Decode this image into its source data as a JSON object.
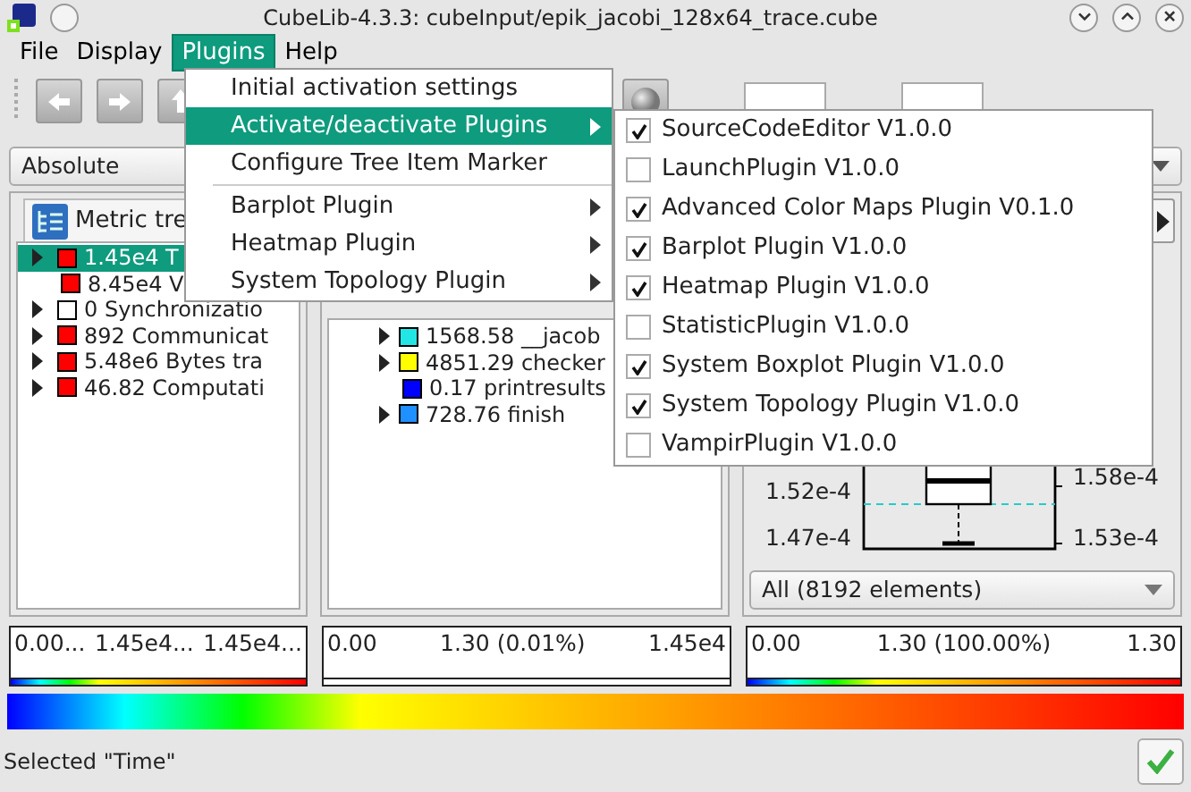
{
  "window": {
    "title": "CubeLib-4.3.3: cubeInput/epik_jacobi_128x64_trace.cube"
  },
  "menubar": [
    {
      "label": "File",
      "selected": false
    },
    {
      "label": "Display",
      "selected": false
    },
    {
      "label": "Plugins",
      "selected": true
    },
    {
      "label": "Help",
      "selected": false
    }
  ],
  "plugins_menu": {
    "items": [
      {
        "kind": "item",
        "label": "Initial activation settings",
        "selected": false,
        "submenu": false
      },
      {
        "kind": "item",
        "label": "Activate/deactivate Plugins",
        "selected": true,
        "submenu": true
      },
      {
        "kind": "item",
        "label": "Configure Tree Item Marker",
        "selected": false,
        "submenu": false
      },
      {
        "kind": "separator"
      },
      {
        "kind": "item",
        "label": "Barplot Plugin",
        "selected": false,
        "submenu": true
      },
      {
        "kind": "item",
        "label": "Heatmap Plugin",
        "selected": false,
        "submenu": true
      },
      {
        "kind": "item",
        "label": "System Topology Plugin",
        "selected": false,
        "submenu": true
      }
    ]
  },
  "plugins_submenu": {
    "items": [
      {
        "label": "SourceCodeEditor V1.0.0",
        "checked": true
      },
      {
        "label": "LaunchPlugin V1.0.0",
        "checked": false
      },
      {
        "label": "Advanced Color Maps Plugin V0.1.0",
        "checked": true
      },
      {
        "label": "Barplot Plugin V1.0.0",
        "checked": true
      },
      {
        "label": "Heatmap Plugin V1.0.0",
        "checked": true
      },
      {
        "label": "StatisticPlugin V1.0.0",
        "checked": false
      },
      {
        "label": "System Boxplot Plugin V1.0.0",
        "checked": true
      },
      {
        "label": "System Topology Plugin V1.0.0",
        "checked": true
      },
      {
        "label": "VampirPlugin V1.0.0",
        "checked": false
      }
    ]
  },
  "left_panel": {
    "mode": "Absolute",
    "tab": "Metric tre",
    "rows": [
      {
        "label": "1.45e4 T",
        "color": "#ff0000",
        "expandable": true,
        "selected": true
      },
      {
        "label": "8.45e4 V",
        "color": "#ff0000",
        "expandable": false,
        "selected": false
      },
      {
        "label": "0 Synchronizatio",
        "color": "#ffffff",
        "expandable": true,
        "selected": false
      },
      {
        "label": "892 Communicat",
        "color": "#ff0000",
        "expandable": true,
        "selected": false
      },
      {
        "label": "5.48e6 Bytes tra",
        "color": "#ff0000",
        "expandable": true,
        "selected": false
      },
      {
        "label": "46.82 Computati",
        "color": "#ff0000",
        "expandable": true,
        "selected": false
      }
    ]
  },
  "middle_panel": {
    "rows": [
      {
        "label": "1568.58 __jacob",
        "color": "#22e6e6",
        "expandable": true
      },
      {
        "label": "4851.29 checker",
        "color": "#ffff00",
        "expandable": true
      },
      {
        "label": "0.17 printresults",
        "color": "#0000ff",
        "expandable": false
      },
      {
        "label": "728.76 finish",
        "color": "#1e90ff",
        "expandable": true
      }
    ]
  },
  "right_panel": {
    "boxplot": {
      "left_ticks": [
        "1.52e-4",
        "1.47e-4"
      ],
      "right_ticks": [
        "1.58e-4",
        "1.53e-4"
      ]
    },
    "scope": "All (8192 elements)"
  },
  "legends": [
    {
      "min": "0.00...",
      "mid": "1.45e4...",
      "max": "1.45e4...",
      "gradient": true
    },
    {
      "min": "0.00",
      "mid": "1.30 (0.01%)",
      "max": "1.45e4",
      "gradient": false
    },
    {
      "min": "0.00",
      "mid": "1.30 (100.00%)",
      "max": "1.30",
      "gradient": true
    }
  ],
  "status_bar": {
    "message": "Selected \"Time\""
  }
}
